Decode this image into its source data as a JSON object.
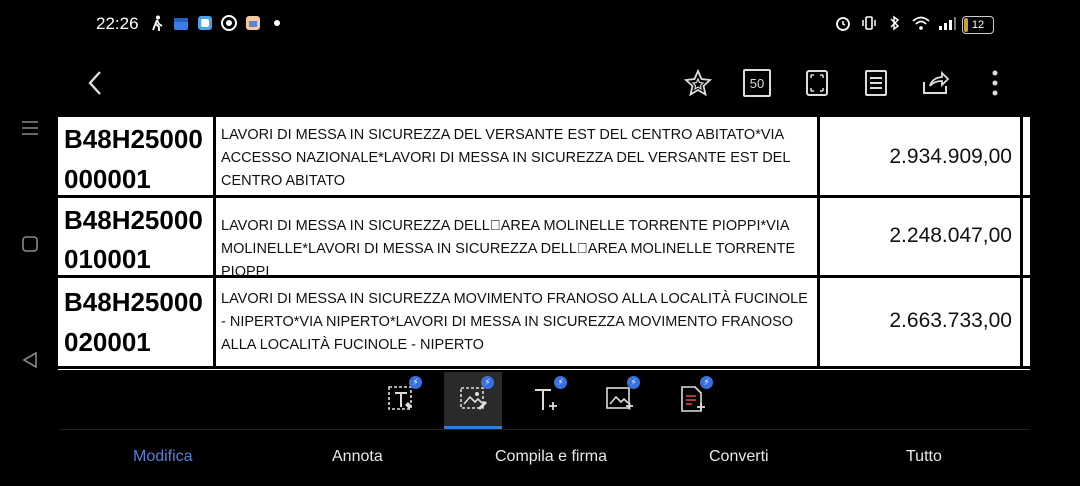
{
  "status_bar": {
    "time": "22:26",
    "battery": "12",
    "left_icons": [
      "walk-icon",
      "calendar-icon",
      "app-icon",
      "chrome-icon",
      "app-icon",
      "dot-icon"
    ],
    "right_icons": [
      "alarm-icon",
      "vibrate-icon",
      "bluetooth-icon",
      "wifi-icon",
      "signal-icon"
    ]
  },
  "toolbar": {
    "page_count_badge": "50"
  },
  "document": {
    "rows": [
      {
        "code_line1": "B48H25000",
        "code_line2": "000001",
        "description": "LAVORI DI MESSA IN SICUREZZA DEL VERSANTE EST DEL CENTRO ABITATO*VIA ACCESSO NAZIONALE*LAVORI DI MESSA IN SICUREZZA DEL VERSANTE EST DEL CENTRO ABITATO",
        "amount": "2.934.909,00"
      },
      {
        "code_line1": "B48H25000",
        "code_line2": "010001",
        "description": "LAVORI DI MESSA IN SICUREZZA DELL\u0000AREA MOLINELLE  TORRENTE PIOPPI*VIA MOLINELLE*LAVORI DI MESSA IN SICUREZZA DELL\u0000AREA MOLINELLE  TORRENTE PIOPPI",
        "amount": "2.248.047,00"
      },
      {
        "code_line1": "B48H25000",
        "code_line2": "020001",
        "description": "LAVORI DI MESSA IN SICUREZZA MOVIMENTO FRANOSO ALLA LOCALITÀ FUCINOLE - NIPERTO*VIA NIPERTO*LAVORI DI MESSA IN SICUREZZA MOVIMENTO FRANOSO ALLA LOCALITÀ FUCINOLE - NIPERTO",
        "amount": "2.663.733,00"
      }
    ]
  },
  "bottom_tabs": [
    {
      "label": "Modifica",
      "active": true
    },
    {
      "label": "Annota",
      "active": false
    },
    {
      "label": "Compila e firma",
      "active": false
    },
    {
      "label": "Converti",
      "active": false
    },
    {
      "label": "Tutto",
      "active": false
    }
  ],
  "colors": {
    "accent": "#5b7fd6",
    "badge_blue": "#3a6fe0"
  }
}
